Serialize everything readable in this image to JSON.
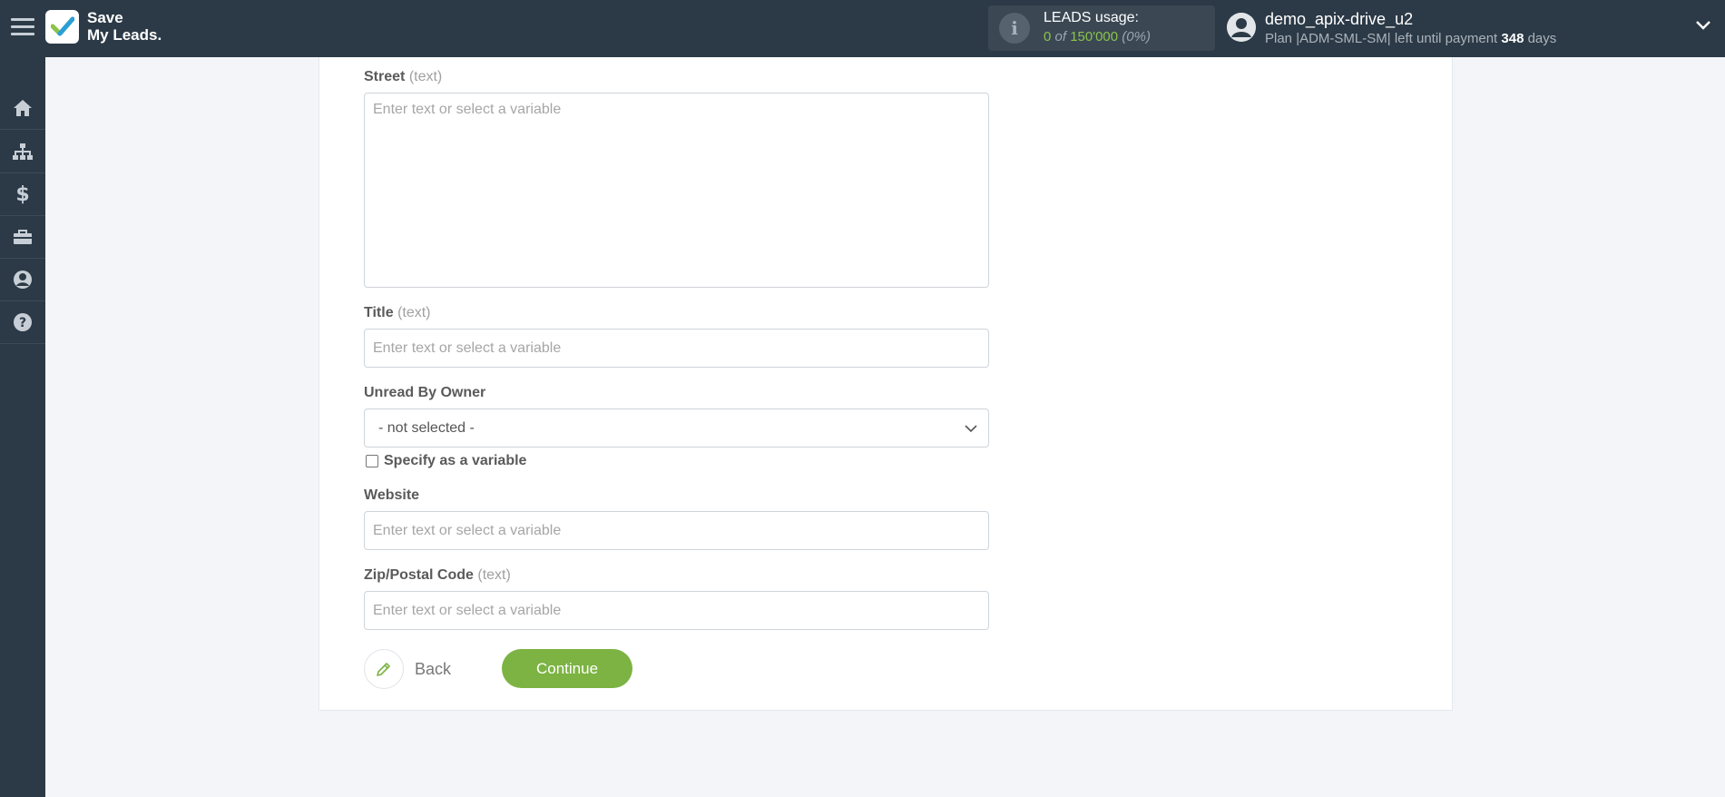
{
  "header": {
    "logo_line1": "Save",
    "logo_line2": "My Leads.",
    "leads_label": "LEADS usage:",
    "leads_used": "0",
    "leads_of": "of",
    "leads_total": "150'000",
    "leads_pct": "(0%)",
    "user_name": "demo_apix-drive_u2",
    "plan_prefix": "Plan |ADM-SML-SM| left until payment",
    "plan_days": "348",
    "plan_suffix": "days"
  },
  "sidebar": {
    "items": [
      {
        "icon": "home-icon"
      },
      {
        "icon": "sitemap-icon"
      },
      {
        "icon": "dollar-icon"
      },
      {
        "icon": "briefcase-icon"
      },
      {
        "icon": "user-icon"
      },
      {
        "icon": "help-icon"
      }
    ]
  },
  "form": {
    "street": {
      "label": "Street",
      "hint": "(text)",
      "placeholder": "Enter text or select a variable"
    },
    "title": {
      "label": "Title",
      "hint": "(text)",
      "placeholder": "Enter text or select a variable"
    },
    "unread": {
      "label": "Unread By Owner",
      "selected": "- not selected -",
      "specify_label": "Specify as a variable"
    },
    "website": {
      "label": "Website",
      "placeholder": "Enter text or select a variable"
    },
    "zip": {
      "label": "Zip/Postal Code",
      "hint": "(text)",
      "placeholder": "Enter text or select a variable"
    },
    "back_label": "Back",
    "continue_label": "Continue"
  },
  "colors": {
    "topbar": "#2c3a47",
    "accent_green": "#7cb342"
  }
}
